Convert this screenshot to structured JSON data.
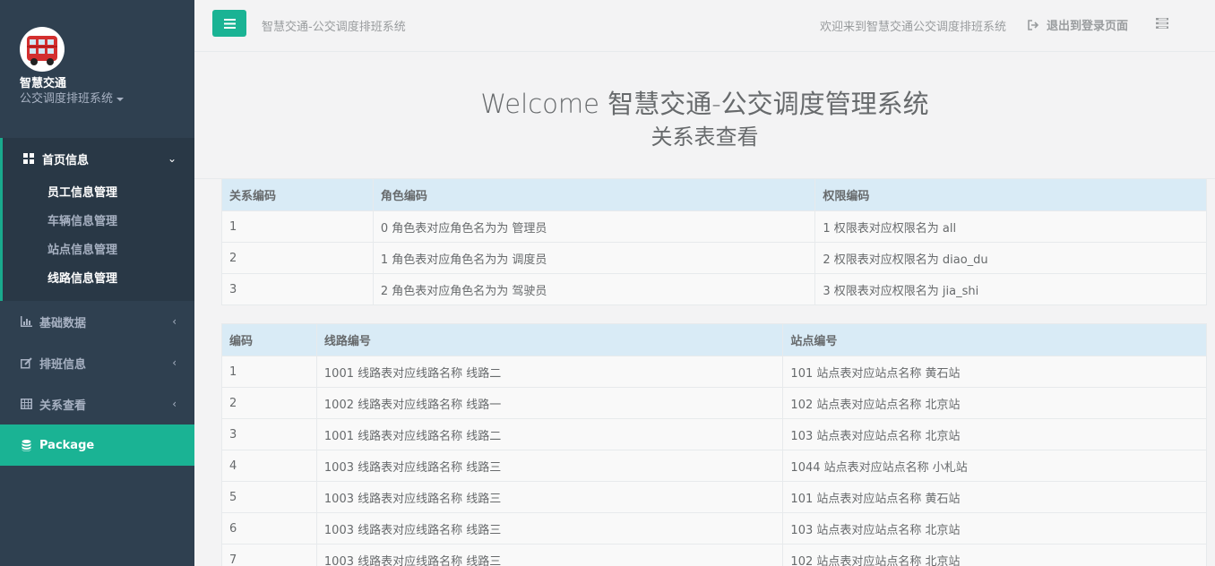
{
  "profile": {
    "name": "智慧交通",
    "role": "公交调度排班系统"
  },
  "nav": {
    "home": "首页信息",
    "sub": [
      "员工信息管理",
      "车辆信息管理",
      "站点信息管理",
      "线路信息管理"
    ],
    "basic": "基础数据",
    "schedule": "排班信息",
    "relation": "关系查看",
    "package": "Package"
  },
  "topbar": {
    "title": "智慧交通-公交调度排班系统",
    "welcome": "欢迎来到智慧交通公交调度排班系统",
    "logout": "退出到登录页面"
  },
  "hero": {
    "title": "Welcome 智慧交通-公交调度管理系统",
    "subtitle": "关系表查看"
  },
  "table1": {
    "headers": [
      "关系编码",
      "角色编码",
      "权限编码"
    ],
    "rows": [
      [
        "1",
        "0 角色表对应角色名为为 管理员",
        "1 权限表对应权限名为 all"
      ],
      [
        "2",
        "1 角色表对应角色名为为 调度员",
        "2 权限表对应权限名为 diao_du"
      ],
      [
        "3",
        "2 角色表对应角色名为为 驾驶员",
        "3 权限表对应权限名为 jia_shi"
      ]
    ]
  },
  "table2": {
    "headers": [
      "编码",
      "线路编号",
      "站点编号"
    ],
    "rows": [
      [
        "1",
        "1001 线路表对应线路名称 线路二",
        "101 站点表对应站点名称 黄石站"
      ],
      [
        "2",
        "1002 线路表对应线路名称 线路一",
        "102 站点表对应站点名称 北京站"
      ],
      [
        "3",
        "1001 线路表对应线路名称 线路二",
        "103 站点表对应站点名称 北京站"
      ],
      [
        "4",
        "1003 线路表对应线路名称 线路三",
        "1044 站点表对应站点名称 小札站"
      ],
      [
        "5",
        "1003 线路表对应线路名称 线路三",
        "101 站点表对应站点名称 黄石站"
      ],
      [
        "6",
        "1003 线路表对应线路名称 线路三",
        "103 站点表对应站点名称 北京站"
      ],
      [
        "7",
        "1003 线路表对应线路名称 线路三",
        "102 站点表对应站点名称 北京站"
      ]
    ]
  },
  "colors": {
    "sidebar": "#2f4050",
    "accent": "#1ab394",
    "header_row": "#d9ebf6"
  }
}
